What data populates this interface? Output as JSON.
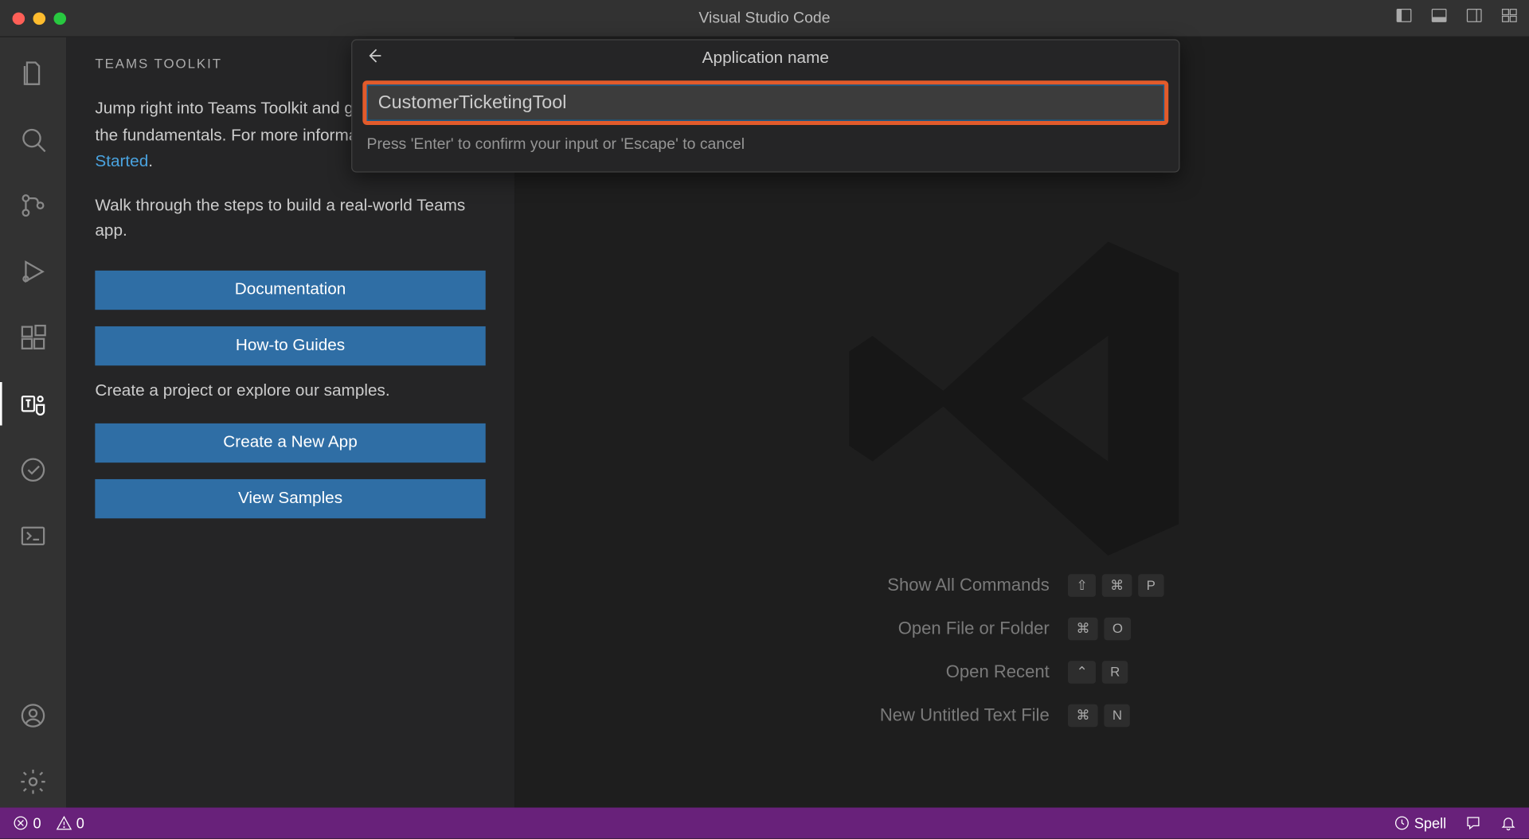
{
  "titlebar": {
    "title": "Visual Studio Code"
  },
  "sidebar": {
    "title": "TEAMS TOOLKIT",
    "intro_prefix": "Jump right into Teams Toolkit and get an overview of the fundamentals. For more information, visit ",
    "intro_link": "Get Started",
    "intro_suffix": ".",
    "walk": "Walk through the steps to build a real-world Teams app.",
    "btn_docs": "Documentation",
    "btn_howto": "How-to Guides",
    "create_label": "Create a project or explore our samples.",
    "btn_create": "Create a New App",
    "btn_samples": "View Samples"
  },
  "shortcuts": {
    "items": [
      {
        "label": "Show All Commands",
        "keys": [
          "⇧",
          "⌘",
          "P"
        ]
      },
      {
        "label": "Open File or Folder",
        "keys": [
          "⌘",
          "O"
        ]
      },
      {
        "label": "Open Recent",
        "keys": [
          "⌃",
          "R"
        ]
      },
      {
        "label": "New Untitled Text File",
        "keys": [
          "⌘",
          "N"
        ]
      }
    ]
  },
  "statusbar": {
    "errors": "0",
    "warnings": "0",
    "spell": "Spell"
  },
  "quickpick": {
    "title": "Application name",
    "value": "CustomerTicketingTool",
    "hint": "Press 'Enter' to confirm your input or 'Escape' to cancel"
  }
}
